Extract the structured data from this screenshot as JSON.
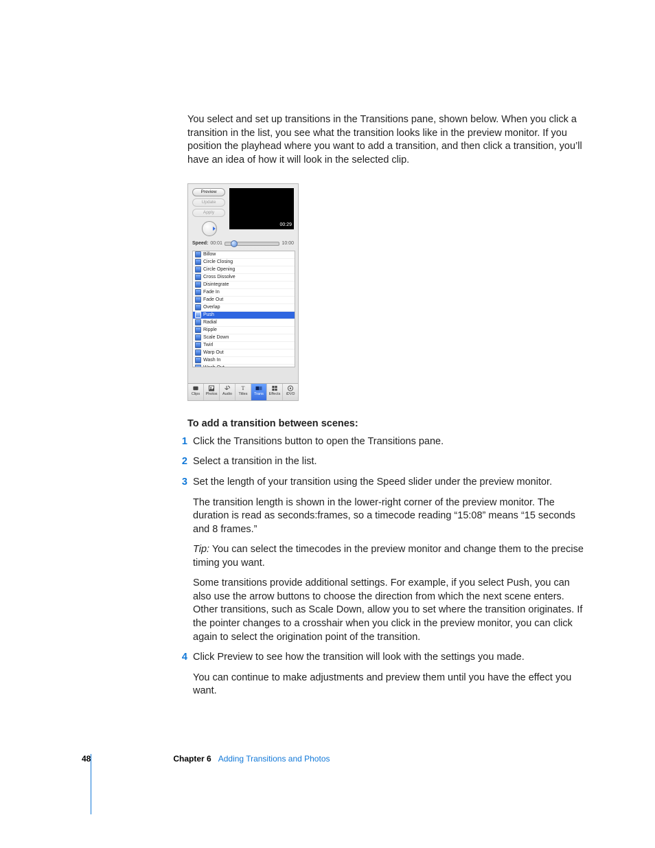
{
  "intro": "You select and set up transitions in the Transitions pane, shown below. When you click a transition in the list, you see what the transition looks like in the preview monitor. If you position the playhead where you want to add a transition, and then click a transition, you’ll have an idea of how it will look in the selected clip.",
  "pane": {
    "buttons": {
      "preview": "Preview",
      "update": "Update",
      "apply": "Apply"
    },
    "preview_time": "00:29",
    "speed": {
      "label": "Speed:",
      "min": "00:01",
      "max": "10:00"
    },
    "transitions": [
      {
        "name": "Billow",
        "selected": false
      },
      {
        "name": "Circle Closing",
        "selected": false
      },
      {
        "name": "Circle Opening",
        "selected": false
      },
      {
        "name": "Cross Dissolve",
        "selected": false
      },
      {
        "name": "Disintegrate",
        "selected": false
      },
      {
        "name": "Fade In",
        "selected": false
      },
      {
        "name": "Fade Out",
        "selected": false
      },
      {
        "name": "Overlap",
        "selected": false
      },
      {
        "name": "Push",
        "selected": true
      },
      {
        "name": "Radial",
        "selected": false
      },
      {
        "name": "Ripple",
        "selected": false
      },
      {
        "name": "Scale Down",
        "selected": false
      },
      {
        "name": "Twirl",
        "selected": false
      },
      {
        "name": "Warp Out",
        "selected": false
      },
      {
        "name": "Wash In",
        "selected": false
      },
      {
        "name": "Wash Out",
        "selected": false
      }
    ],
    "tabs": [
      {
        "label": "Clips",
        "active": false
      },
      {
        "label": "Photos",
        "active": false
      },
      {
        "label": "Audio",
        "active": false
      },
      {
        "label": "Titles",
        "active": false
      },
      {
        "label": "Trans",
        "active": true
      },
      {
        "label": "Effects",
        "active": false
      },
      {
        "label": "iDVD",
        "active": false
      }
    ]
  },
  "howto_heading": "To add a transition between scenes:",
  "steps": {
    "1": {
      "text": "Click the Transitions button to open the Transitions pane."
    },
    "2": {
      "text": "Select a transition in the list."
    },
    "3": {
      "text": "Set the length of your transition using the Speed slider under the preview monitor.",
      "para_a": "The transition length is shown in the lower-right corner of the preview monitor. The duration is read as seconds:frames, so a timecode reading “15:08” means “15 seconds and 8 frames.”",
      "tip_label": "Tip:",
      "tip_body": "  You can select the timecodes in the preview monitor and change them to the precise timing you want.",
      "para_b": "Some transitions provide additional settings. For example, if you select Push, you can also use the arrow buttons to choose the direction from which the next scene enters. Other transitions, such as Scale Down, allow you to set where the transition originates. If the pointer changes to a crosshair when you click in the preview monitor, you can click again to select the origination point of the transition."
    },
    "4": {
      "text": "Click Preview to see how the transition will look with the settings you made.",
      "para_a": "You can continue to make adjustments and preview them until you have the effect you want."
    }
  },
  "footer": {
    "page": "48",
    "chapter": "Chapter 6",
    "title": "Adding Transitions and Photos"
  }
}
